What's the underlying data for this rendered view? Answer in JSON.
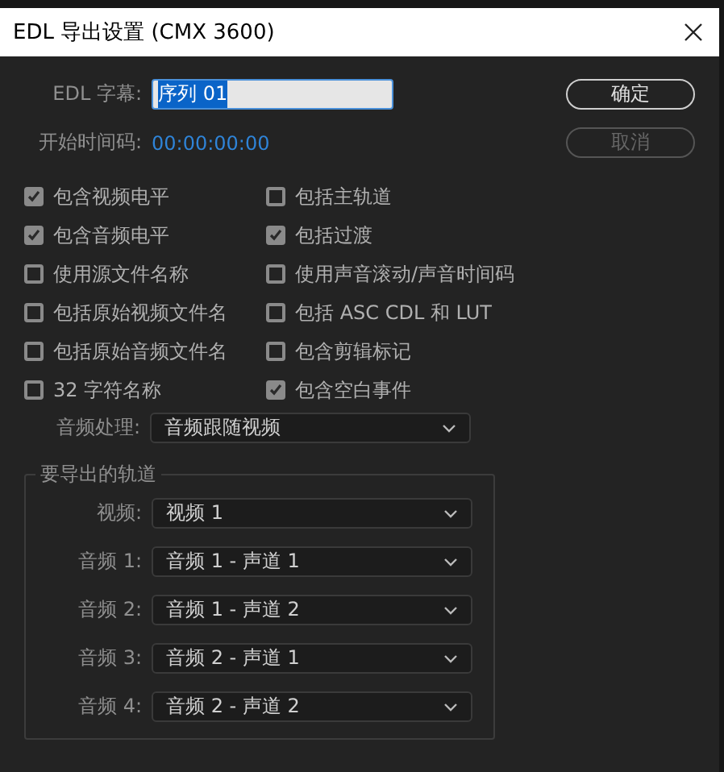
{
  "window": {
    "title": "EDL 导出设置 (CMX 3600)"
  },
  "edl_title": {
    "label": "EDL 字幕:",
    "value": "序列 01",
    "text_selected": true
  },
  "start_timecode": {
    "label": "开始时间码:",
    "value": "00:00:00:00"
  },
  "buttons": [
    {
      "label": "确定",
      "disabled": false
    },
    {
      "label": "取消",
      "disabled": true
    }
  ],
  "options": [
    {
      "label": "包含视频电平",
      "checked": true
    },
    {
      "label": "包括主轨道",
      "checked": false
    },
    {
      "label": "包含音频电平",
      "checked": true
    },
    {
      "label": "包括过渡",
      "checked": true
    },
    {
      "label": "使用源文件名称",
      "checked": false
    },
    {
      "label": "使用声音滚动/声音时间码",
      "checked": false
    },
    {
      "label": "包括原始视频文件名",
      "checked": false
    },
    {
      "label": "包括 ASC CDL 和 LUT",
      "checked": false
    },
    {
      "label": "包括原始音频文件名",
      "checked": false
    },
    {
      "label": "包含剪辑标记",
      "checked": false
    },
    {
      "label": "32 字符名称",
      "checked": false
    },
    {
      "label": "包含空白事件",
      "checked": true
    }
  ],
  "audio_processing": {
    "label": "音频处理:",
    "value": "音频跟随视频"
  },
  "tracks": {
    "title": "要导出的轨道",
    "rows": [
      {
        "label": "视频:",
        "value": "视频 1"
      },
      {
        "label": "音频 1:",
        "value": "音频 1 - 声道 1"
      },
      {
        "label": "音频 2:",
        "value": "音频 1 - 声道 2"
      },
      {
        "label": "音频 3:",
        "value": "音频 2 - 声道 1"
      },
      {
        "label": "音频 4:",
        "value": "音频 2 - 声道 2"
      }
    ]
  }
}
